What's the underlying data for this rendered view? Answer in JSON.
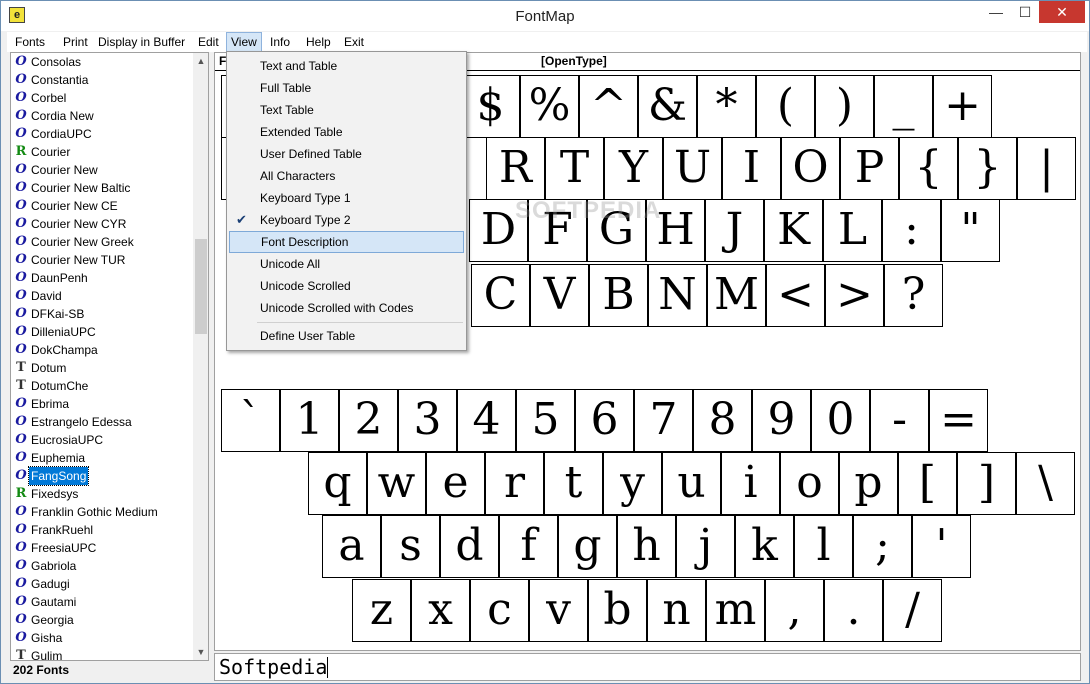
{
  "window": {
    "title": "FontMap",
    "icon_glyph": "e"
  },
  "title_buttons": {
    "minimize": "—",
    "maximize": "☐",
    "close": "✕"
  },
  "menubar": [
    "Fonts",
    "Print",
    "Display in Buffer",
    "Edit",
    "View",
    "Info",
    "Help",
    "Exit"
  ],
  "active_menu": "View",
  "font_list": {
    "items": [
      {
        "icon": "O",
        "type": "opentype",
        "name": "Consolas"
      },
      {
        "icon": "O",
        "type": "opentype",
        "name": "Constantia"
      },
      {
        "icon": "O",
        "type": "opentype",
        "name": "Corbel"
      },
      {
        "icon": "O",
        "type": "opentype",
        "name": "Cordia New"
      },
      {
        "icon": "O",
        "type": "opentype",
        "name": "CordiaUPC"
      },
      {
        "icon": "R",
        "type": "raster",
        "name": "Courier"
      },
      {
        "icon": "O",
        "type": "opentype",
        "name": "Courier New"
      },
      {
        "icon": "O",
        "type": "opentype",
        "name": "Courier New Baltic"
      },
      {
        "icon": "O",
        "type": "opentype",
        "name": "Courier New CE"
      },
      {
        "icon": "O",
        "type": "opentype",
        "name": "Courier New CYR"
      },
      {
        "icon": "O",
        "type": "opentype",
        "name": "Courier New Greek"
      },
      {
        "icon": "O",
        "type": "opentype",
        "name": "Courier New TUR"
      },
      {
        "icon": "O",
        "type": "opentype",
        "name": "DaunPenh"
      },
      {
        "icon": "O",
        "type": "opentype",
        "name": "David"
      },
      {
        "icon": "O",
        "type": "opentype",
        "name": "DFKai-SB"
      },
      {
        "icon": "O",
        "type": "opentype",
        "name": "DilleniaUPC"
      },
      {
        "icon": "O",
        "type": "opentype",
        "name": "DokChampa"
      },
      {
        "icon": "T",
        "type": "truetype",
        "name": "Dotum"
      },
      {
        "icon": "T",
        "type": "truetype",
        "name": "DotumChe"
      },
      {
        "icon": "O",
        "type": "opentype",
        "name": "Ebrima"
      },
      {
        "icon": "O",
        "type": "opentype",
        "name": "Estrangelo Edessa"
      },
      {
        "icon": "O",
        "type": "opentype",
        "name": "EucrosiaUPC"
      },
      {
        "icon": "O",
        "type": "opentype",
        "name": "Euphemia"
      },
      {
        "icon": "O",
        "type": "opentype",
        "name": "FangSong",
        "selected": true
      },
      {
        "icon": "R",
        "type": "raster",
        "name": "Fixedsys"
      },
      {
        "icon": "O",
        "type": "opentype",
        "name": "Franklin Gothic Medium"
      },
      {
        "icon": "O",
        "type": "opentype",
        "name": "FrankRuehl"
      },
      {
        "icon": "O",
        "type": "opentype",
        "name": "FreesiaUPC"
      },
      {
        "icon": "O",
        "type": "opentype",
        "name": "Gabriola"
      },
      {
        "icon": "O",
        "type": "opentype",
        "name": "Gadugi"
      },
      {
        "icon": "O",
        "type": "opentype",
        "name": "Gautami"
      },
      {
        "icon": "O",
        "type": "opentype",
        "name": "Georgia"
      },
      {
        "icon": "O",
        "type": "opentype",
        "name": "Gisha"
      },
      {
        "icon": "T",
        "type": "truetype",
        "name": "Gulim"
      }
    ],
    "count_label": "202 Fonts"
  },
  "keyboard": {
    "header_label": "F",
    "header_type": "[OpenType]",
    "shift_rows": [
      [
        "$",
        "%",
        "^",
        "&",
        "*",
        "(",
        ")",
        "_",
        "+"
      ],
      [
        "R",
        "T",
        "Y",
        "U",
        "I",
        "O",
        "P",
        "{",
        "}",
        "|"
      ],
      [
        "D",
        "F",
        "G",
        "H",
        "J",
        "K",
        "L",
        ":",
        "\""
      ],
      [
        "C",
        "V",
        "B",
        "N",
        "M",
        "<",
        ">",
        "?"
      ]
    ],
    "normal_rows": [
      [
        "`",
        "1",
        "2",
        "3",
        "4",
        "5",
        "6",
        "7",
        "8",
        "9",
        "0",
        "-",
        "="
      ],
      [
        "q",
        "w",
        "e",
        "r",
        "t",
        "y",
        "u",
        "i",
        "o",
        "p",
        "[",
        "]",
        "\\"
      ],
      [
        "a",
        "s",
        "d",
        "f",
        "g",
        "h",
        "j",
        "k",
        "l",
        ";",
        "'"
      ],
      [
        "z",
        "x",
        "c",
        "v",
        "b",
        "n",
        "m",
        ",",
        ".",
        "/"
      ]
    ]
  },
  "sample_text": "Softpedia",
  "watermark": "SOFTPEDIA",
  "view_menu": {
    "items": [
      {
        "label": "Text and Table"
      },
      {
        "label": "Full Table"
      },
      {
        "label": "Text Table"
      },
      {
        "label": "Extended Table"
      },
      {
        "label": "User Defined Table"
      },
      {
        "label": "All Characters"
      },
      {
        "label": "Keyboard Type 1"
      },
      {
        "label": "Keyboard Type 2",
        "checked": true
      },
      {
        "label": "Font Description",
        "highlighted": true
      },
      {
        "label": "Unicode All"
      },
      {
        "label": "Unicode Scrolled"
      },
      {
        "label": "Unicode Scrolled with Codes"
      },
      {
        "label": "Define User Table"
      }
    ]
  },
  "colors": {
    "accent": "#0078d7",
    "close": "#c7372f",
    "menu_highlight": "#d5e6f7"
  }
}
